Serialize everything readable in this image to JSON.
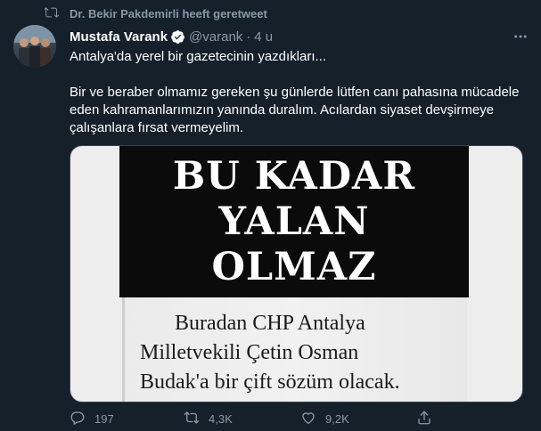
{
  "retweet": {
    "label": "Dr. Bekir Pakdemirli heeft geretweet",
    "icon": "retweet-icon"
  },
  "author": {
    "name": "Mustafa Varank",
    "handle": "@varank",
    "separator": "·",
    "time": "4 u",
    "verified": true
  },
  "tweet": {
    "line1": "Antalya'da yerel bir gazetecinin yazdıkları...",
    "line2": "Bir ve beraber olmamız gereken şu günlerde lütfen canı pahasına mücadele eden kahramanlarımızın yanında duralım. Acılardan siyaset devşirmeye çalışanlara fırsat vermeyelim."
  },
  "media": {
    "headline": [
      "BU KADAR",
      "YALAN",
      "OLMAZ"
    ],
    "body_lines": [
      "Buradan CHP Antalya",
      "Milletvekili Çetin Osman",
      "Budak'a bir çift sözüm olacak."
    ]
  },
  "actions": {
    "replies": "197",
    "retweets": "4,3K",
    "likes": "9,2K"
  },
  "colors": {
    "background": "#15202b",
    "muted": "#8899a6",
    "accent": "#1da1f2"
  }
}
